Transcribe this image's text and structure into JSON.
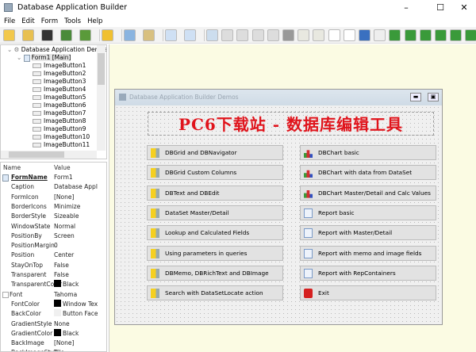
{
  "window": {
    "title": "Database Application Builder"
  },
  "menu": [
    "File",
    "Edit",
    "Form",
    "Tools",
    "Help"
  ],
  "toolbar": [
    "new-icon",
    "open-icon",
    "save-icon",
    "import-icon",
    "run-icon",
    "lightbulb-icon",
    "copy-icon",
    "paste-icon",
    "page-icon",
    "preview-icon",
    "pointer-icon",
    "panel-icon",
    "frame-icon",
    "groupbox-icon",
    "tabs-icon",
    "splitter-icon",
    "button-icon",
    "checkbutton-icon",
    "label-big-icon",
    "label-icon",
    "image-icon",
    "edit-line-icon",
    "edit-icon",
    "checkbox-icon",
    "radio-icon",
    "combobox-icon",
    "spin-icon",
    "calendar-icon",
    "grid-icon",
    "more-icon"
  ],
  "tree": {
    "root": "Database Application Demos [I",
    "form": "Form1 [Main]",
    "items": [
      "ImageButton1",
      "ImageButton2",
      "ImageButton3",
      "ImageButton4",
      "ImageButton5",
      "ImageButton6",
      "ImageButton7",
      "ImageButton8",
      "ImageButton9",
      "ImageButton10",
      "ImageButton11"
    ]
  },
  "props": {
    "name_header": "Name",
    "value_header": "Value",
    "rows": [
      {
        "n": "FormName",
        "v": "Form1"
      },
      {
        "n": "Caption",
        "v": "Database Applica"
      },
      {
        "n": "FormIcon",
        "v": "[None]"
      },
      {
        "n": "BorderIcons",
        "v": "Minimize"
      },
      {
        "n": "BorderStyle",
        "v": "Sizeable"
      },
      {
        "n": "WindowState",
        "v": "Normal"
      },
      {
        "n": "PositionBy",
        "v": "Screen"
      },
      {
        "n": "PositionMargin",
        "v": "0"
      },
      {
        "n": "Position",
        "v": "Center"
      },
      {
        "n": "StayOnTop",
        "v": "False"
      },
      {
        "n": "Transparent",
        "v": "False"
      },
      {
        "n": "TransparentColor",
        "v": "Black",
        "c": "#000000"
      },
      {
        "n": "Font",
        "v": "Tahoma"
      },
      {
        "n": "FontColor",
        "v": "Window Text",
        "c": "#000000"
      },
      {
        "n": "BackColor",
        "v": "Button Face",
        "c": "#f0f0f0"
      },
      {
        "n": "GradientStyle",
        "v": "None"
      },
      {
        "n": "GradientColor",
        "v": "Black",
        "c": "#000000"
      },
      {
        "n": "BackImage",
        "v": "[None]"
      },
      {
        "n": "BackImageStyle",
        "v": "Tile"
      }
    ]
  },
  "form": {
    "title": "Database Application Builder Demos",
    "banner": "PC6下载站 - 数据库编辑工具",
    "left": [
      "DBGrid and DBNavigator",
      "DBGrid Custom Columns",
      "DBText and DBEdit",
      "DataSet Master/Detail",
      "Lookup and Calculated Fields",
      "Using parameters in queries",
      "DBMemo, DBRichText and DBImage",
      "Search with DataSetLocate action"
    ],
    "right": [
      "DBChart basic",
      "DBChart with data from DataSet",
      "DBChart Master/Detail and Calc Values",
      "Report basic",
      "Report with Master/Detail",
      "Report with memo and image fields",
      "Report with RepContainers",
      "Exit"
    ]
  }
}
